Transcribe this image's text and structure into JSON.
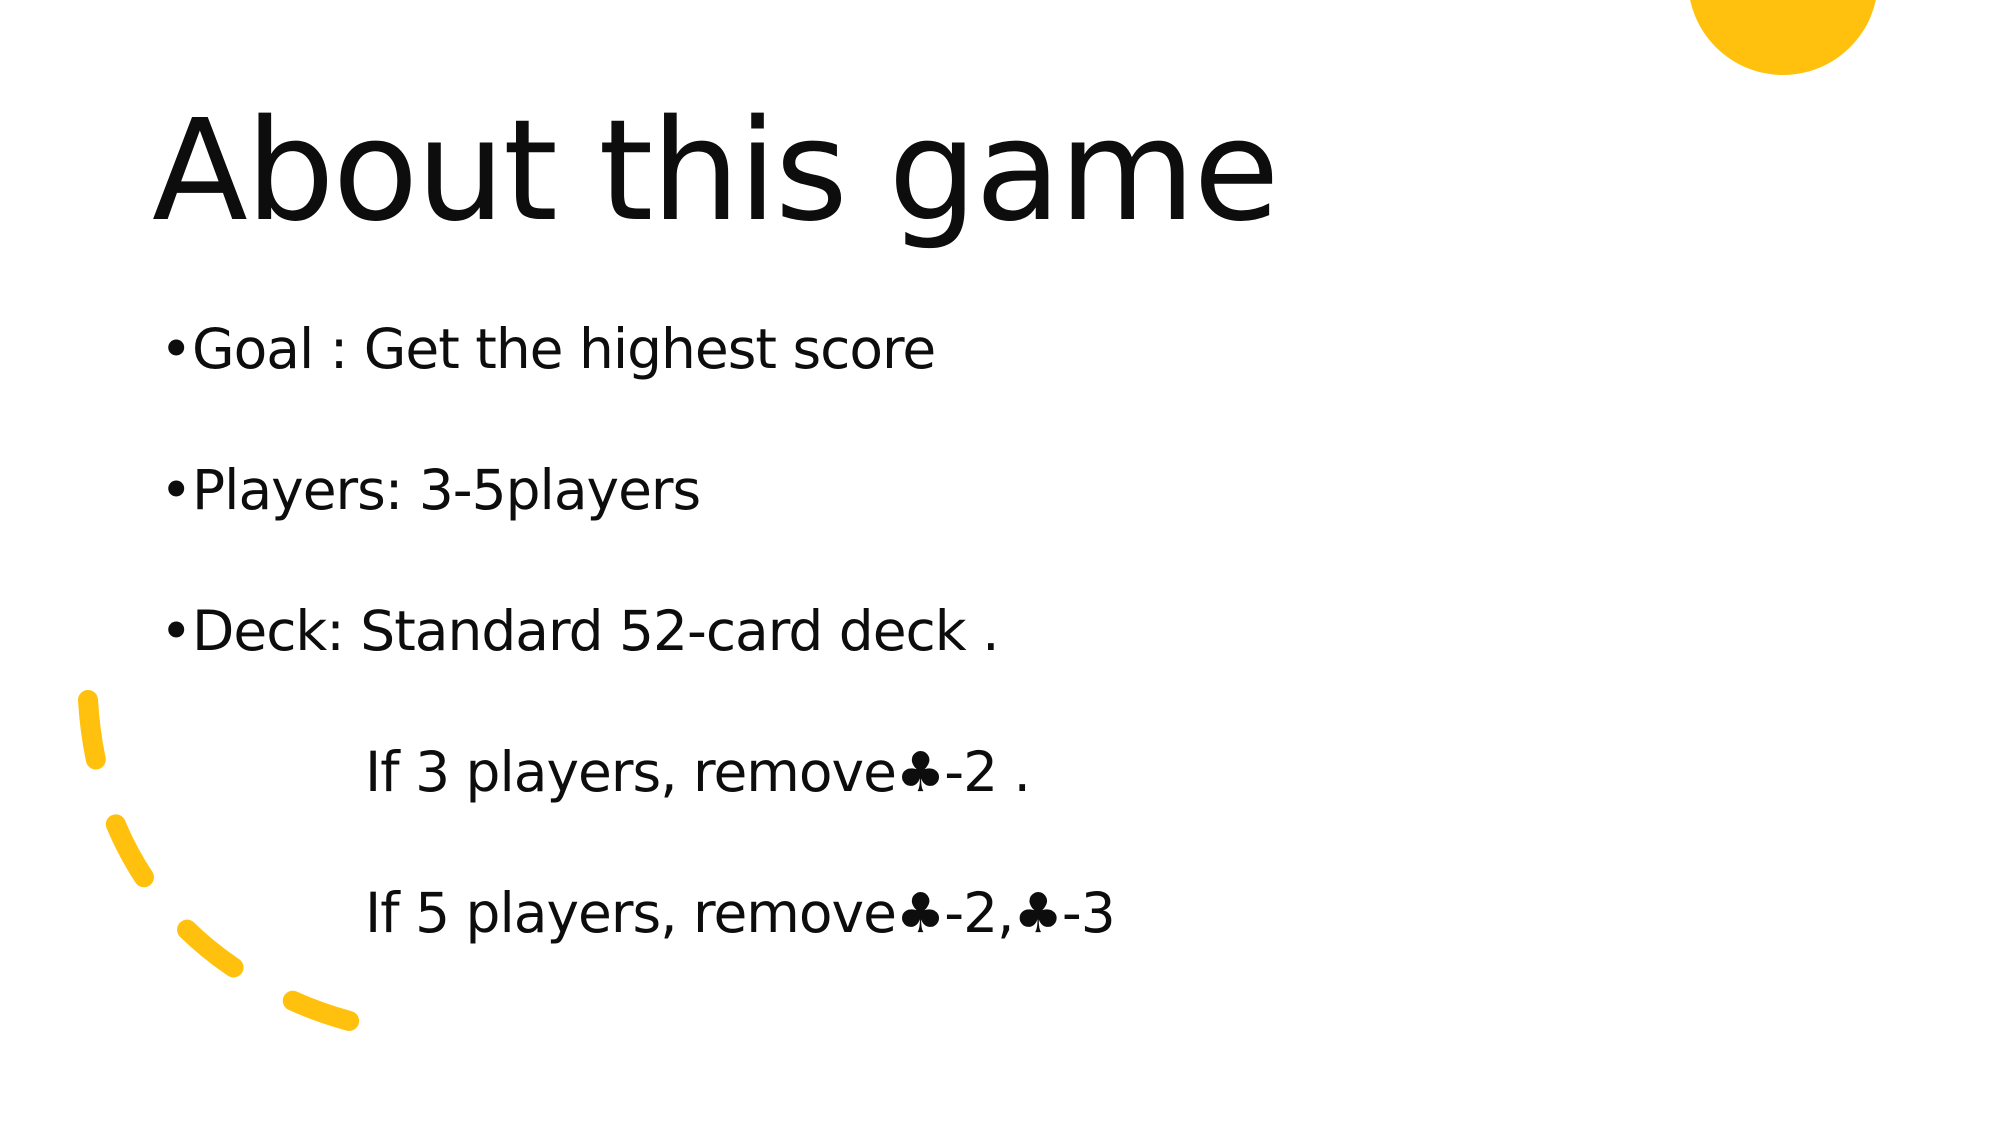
{
  "slide": {
    "title": "About this game",
    "bullets": [
      {
        "marker": "•",
        "text": "Goal : Get the highest score"
      },
      {
        "marker": "•",
        "text": "Players: 3-5players"
      },
      {
        "marker": "•",
        "text": "Deck: Standard 52-card deck ."
      }
    ],
    "sub_lines": [
      "If 3 players, remove♣-2 .",
      "If 5 players, remove♣-2,♣-3"
    ]
  },
  "colors": {
    "accent": "#FFC10E",
    "text": "#0D0D0D",
    "background": "#FFFFFF"
  }
}
